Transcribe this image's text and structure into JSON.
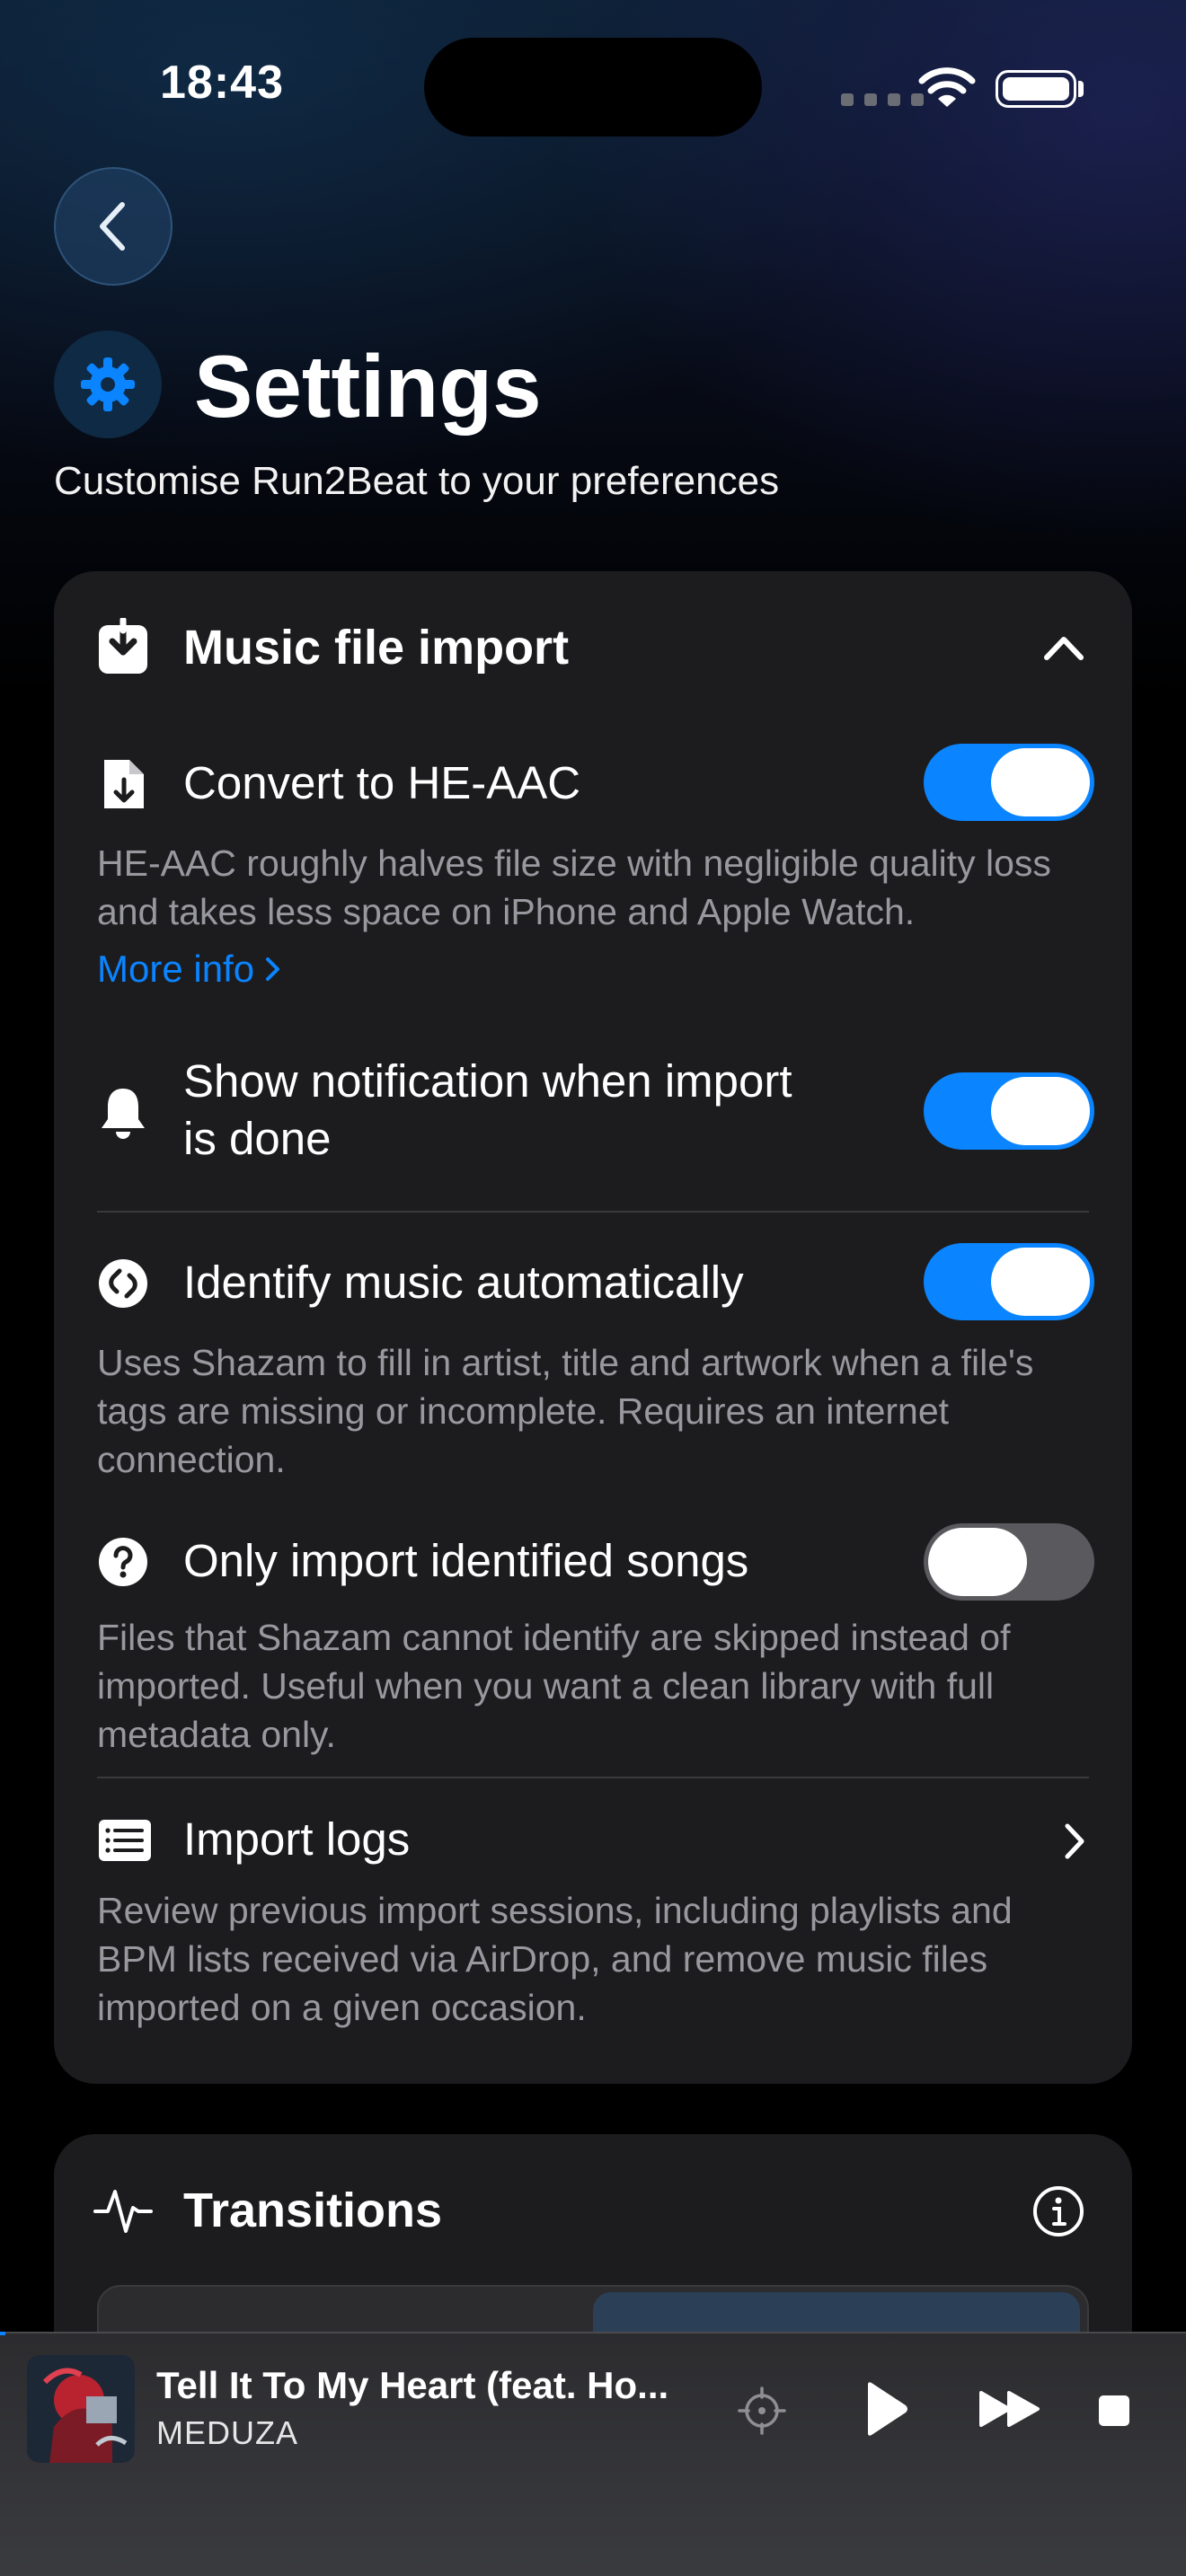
{
  "status_bar": {
    "time": "18:43"
  },
  "header": {
    "title": "Settings",
    "subtitle": "Customise Run2Beat to your preferences"
  },
  "music_import": {
    "section_title": "Music file import",
    "convert": {
      "label": "Convert to HE-AAC",
      "enabled": true,
      "description": "HE-AAC roughly halves file size with negligible quality loss and takes less space on iPhone and Apple Watch.",
      "link": "More info"
    },
    "notification": {
      "label_line1": "Show notification when import",
      "label_line2": "is done",
      "enabled": true
    },
    "identify": {
      "label": "Identify music automatically",
      "enabled": true,
      "description": "Uses Shazam to fill in artist, title and artwork when a file's tags are missing or incomplete. Requires an internet connection."
    },
    "only_identified": {
      "label": "Only import identified songs",
      "enabled": false,
      "description": "Files that Shazam cannot identify are skipped instead of imported. Useful when you want a clean library with full metadata only."
    },
    "import_logs": {
      "label": "Import logs",
      "description": "Review previous import sessions, including playlists and BPM lists received via AirDrop, and remove music files imported on a given occasion."
    }
  },
  "transitions": {
    "section_title": "Transitions"
  },
  "player": {
    "title": "Tell It To My Heart (feat. Ho...",
    "artist": "MEDUZA"
  },
  "colors": {
    "accent": "#0a84ff",
    "card": "#1c1c1e",
    "secondary_text": "#98989f"
  }
}
